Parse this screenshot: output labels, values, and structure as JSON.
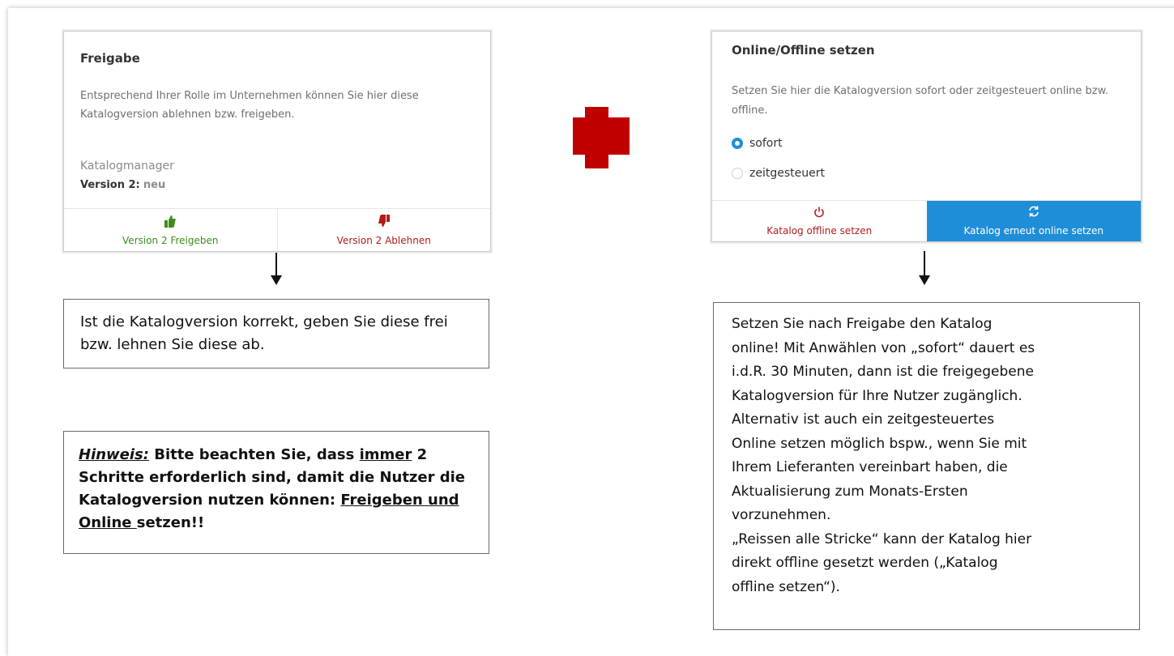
{
  "approval_panel": {
    "title": "Freigabe",
    "description": "Entsprechend Ihrer Rolle im Unternehmen können Sie hier diese Katalogversion ablehnen bzw. freigeben.",
    "role": "Katalogmanager",
    "version_label": "Version 2:",
    "version_status": "neu",
    "approve_label": "Version 2 Freigeben",
    "reject_label": "Version 2 Ablehnen",
    "approve_icon": "thumbs-up-icon",
    "reject_icon": "thumbs-down-icon"
  },
  "online_panel": {
    "title": "Online/Offline setzen",
    "description": "Setzen Sie hier die Katalogversion sofort oder zeitgesteuert online bzw. offline.",
    "options": [
      {
        "label": "sofort",
        "selected": true
      },
      {
        "label": "zeitgesteuert",
        "selected": false
      }
    ],
    "offline_label": "Katalog offline setzen",
    "online_label": "Katalog erneut online setzen",
    "offline_icon": "power-icon",
    "online_icon": "refresh-icon"
  },
  "notes": {
    "approval_note": "Ist die Katalogversion korrekt, geben Sie diese frei bzw. lehnen Sie diese ab.",
    "hint_label": "Hinweis:",
    "hint_part1": " Bitte beachten Sie, dass ",
    "hint_underlined1": "immer",
    "hint_part2": " 2 Schritte erforderlich sind, damit die Nutzer die Katalogversion nutzen können: ",
    "hint_underlined2": "Freigeben und Online ",
    "hint_part3": "setzen!!",
    "online_note_lines": [
      "Setzen Sie nach Freigabe den Katalog",
      "online! Mit Anwählen von „sofort“ dauert es",
      "i.d.R. 30 Minuten, dann ist die freigegebene",
      "Katalogversion für Ihre Nutzer zugänglich.",
      "Alternativ ist auch ein zeitgesteuertes",
      "Online setzen möglich bspw., wenn Sie mit",
      "Ihrem Lieferanten vereinbart haben, die",
      "Aktualisierung zum Monats-Ersten",
      "vorzunehmen.",
      "„Reissen alle Stricke“ kann der Katalog hier",
      "direkt offline gesetzt werden („Katalog",
      "offline setzen“)."
    ]
  },
  "colors": {
    "accent_blue": "#1f8ed8",
    "approve_green": "#3c8d1c",
    "reject_red": "#b31b1b",
    "plus_red": "#c00000"
  }
}
